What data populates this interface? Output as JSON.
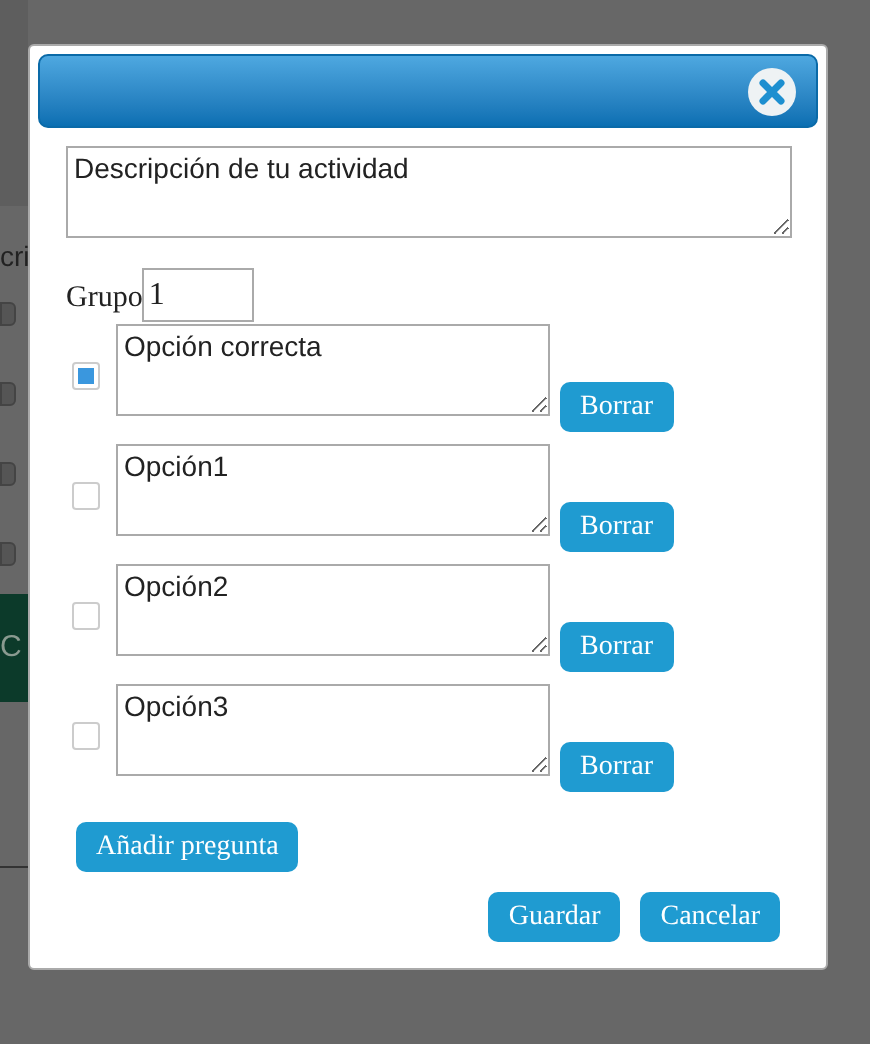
{
  "background": {
    "heading_fragment": "cri",
    "checkboxes": [
      {
        "checked": false
      },
      {
        "checked": false
      },
      {
        "checked": false
      },
      {
        "checked": false
      }
    ],
    "button_fragment": "C"
  },
  "dialog": {
    "description": "Descripción de tu actividad",
    "group_label": "Grupo",
    "group_value": "1",
    "options": [
      {
        "text": "Opción correcta",
        "checked": true,
        "delete_label": "Borrar"
      },
      {
        "text": "Opción1",
        "checked": false,
        "delete_label": "Borrar"
      },
      {
        "text": "Opción2",
        "checked": false,
        "delete_label": "Borrar"
      },
      {
        "text": "Opción3",
        "checked": false,
        "delete_label": "Borrar"
      }
    ],
    "add_button": "Añadir pregunta",
    "buttons": [
      "Guardar",
      "Cancelar"
    ]
  }
}
